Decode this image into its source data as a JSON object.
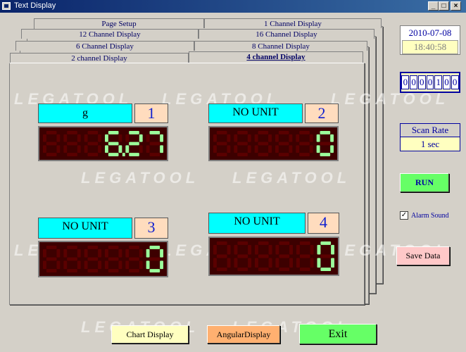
{
  "window": {
    "title": "Text Display"
  },
  "tabs": {
    "page_setup": "Page Setup",
    "ch1": "1 Channel Display",
    "ch12": "12 Channel Display",
    "ch16": "16 Channel Display",
    "ch6": "6 Channel Display",
    "ch8": "8 Channel Display",
    "ch2": "2 channel Display",
    "ch4": "4 channel Display"
  },
  "watermark": "LEGATOOL",
  "channels": [
    {
      "unit": "g",
      "number": "1",
      "value": "6.27"
    },
    {
      "unit": "NO UNIT",
      "number": "2",
      "value": "0"
    },
    {
      "unit": "NO UNIT",
      "number": "3",
      "value": "0"
    },
    {
      "unit": "NO UNIT",
      "number": "4",
      "value": "0"
    }
  ],
  "side": {
    "date": "2010-07-08",
    "time": "18:40:58",
    "counter": "0000100",
    "scan_rate_label": "Scan Rate",
    "scan_rate_value": "1 sec",
    "run_label": "RUN",
    "alarm_label": "Alarm Sound",
    "alarm_checked": true,
    "save_label": "Save Data"
  },
  "bottom": {
    "chart_label": "Chart Display",
    "angular_label": "AngularDisplay",
    "exit_label": "Exit"
  },
  "colors": {
    "unit_bg": "#00ffff",
    "number_bg": "#ffdcbe",
    "lcd_bg": "#3d0000",
    "seg_on": "#9bff9b",
    "seg_off": "#5a0000",
    "run_bg": "#66ff66",
    "save_bg": "#ffc8c8",
    "chart_bg": "#ffffc0",
    "angular_bg": "#ffb070",
    "exit_bg": "#66ff66"
  }
}
